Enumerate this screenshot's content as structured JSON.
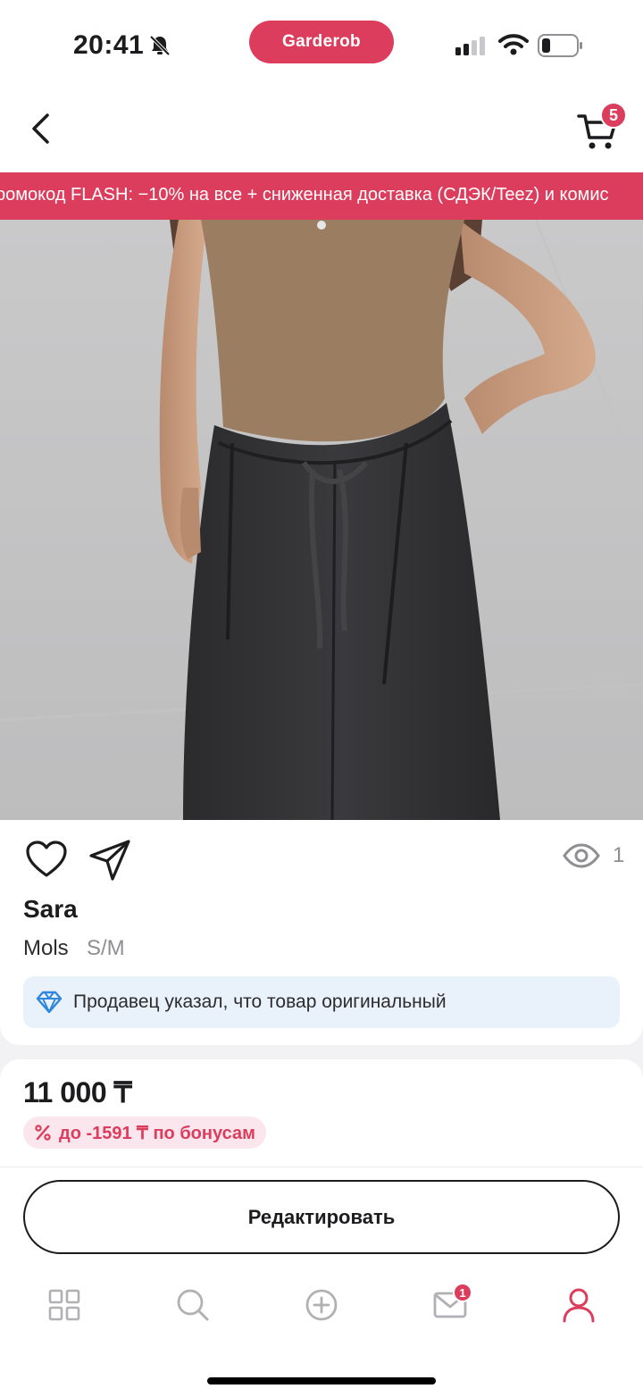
{
  "status_bar": {
    "time": "20:41",
    "app_pill": "Garderob"
  },
  "header": {
    "cart_count": "5"
  },
  "banner": {
    "text": "ромокод FLASH: −10% на все + сниженная доставка (СДЭК/Teez) и комис"
  },
  "product": {
    "views": "1",
    "title": "Sara",
    "brand": "Mols",
    "size": "S/M",
    "original_notice": "Продавец указал, что товар оригинальный",
    "price": "11 000 ₸",
    "bonus": "до -1591 ₸ по бонусам"
  },
  "actions": {
    "edit_label": "Редактировать"
  },
  "tab_bar": {
    "messages_badge": "1",
    "tabs": [
      "grid-icon",
      "search-icon",
      "add-circle-icon",
      "mail-icon",
      "profile-icon"
    ]
  },
  "colors": {
    "accent": "#dc3d5c",
    "notice_bg": "#e9f1fb",
    "bonus_bg": "#fbe6ee"
  }
}
